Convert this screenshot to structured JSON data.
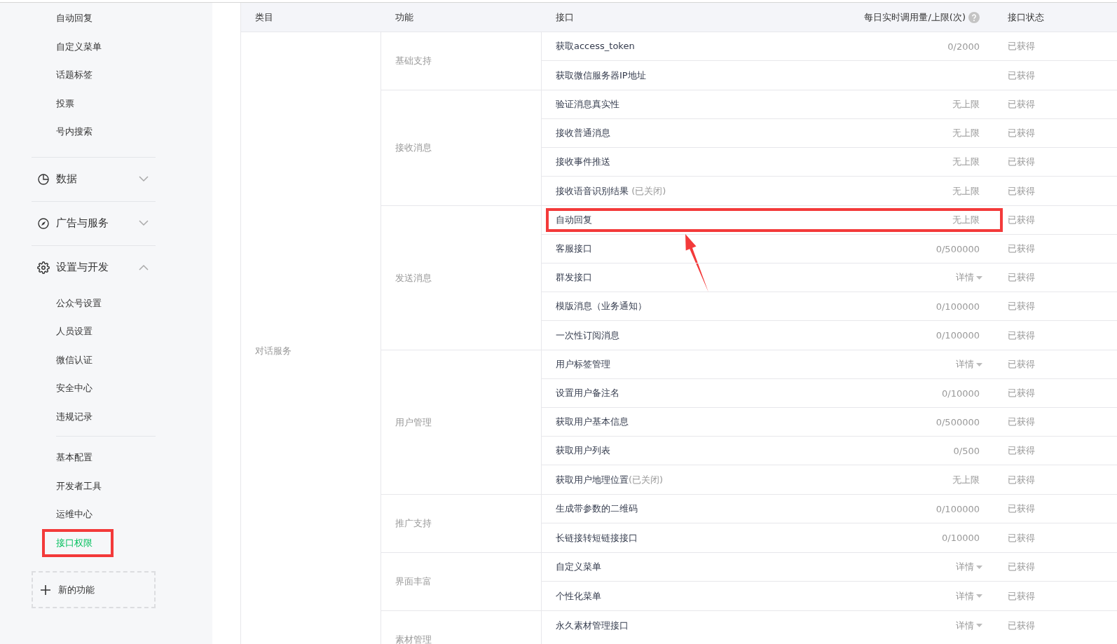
{
  "sidebar": {
    "items": [
      {
        "label": "自动回复",
        "selected": false,
        "annotated": false
      },
      {
        "label": "自定义菜单",
        "selected": false,
        "annotated": false
      },
      {
        "label": "话题标签",
        "selected": false,
        "annotated": false
      },
      {
        "label": "投票",
        "selected": false,
        "annotated": false
      },
      {
        "label": "号内搜索",
        "selected": false,
        "annotated": false
      }
    ],
    "sections": [
      {
        "label": "数据",
        "expanded": false
      },
      {
        "label": "广告与服务",
        "expanded": false
      },
      {
        "label": "设置与开发",
        "expanded": true,
        "groups": [
          [
            {
              "label": "公众号设置",
              "selected": false,
              "annotated": false
            },
            {
              "label": "人员设置",
              "selected": false,
              "annotated": false
            },
            {
              "label": "微信认证",
              "selected": false,
              "annotated": false
            },
            {
              "label": "安全中心",
              "selected": false,
              "annotated": false
            },
            {
              "label": "违规记录",
              "selected": false,
              "annotated": false
            }
          ],
          [
            {
              "label": "基本配置",
              "selected": false,
              "annotated": false
            },
            {
              "label": "开发者工具",
              "selected": false,
              "annotated": false
            },
            {
              "label": "运维中心",
              "selected": false,
              "annotated": false
            },
            {
              "label": "接口权限",
              "selected": true,
              "annotated": true
            }
          ]
        ]
      }
    ],
    "new_feature_button": "新的功能"
  },
  "table": {
    "columns": [
      {
        "label": "类目"
      },
      {
        "label": "功能"
      },
      {
        "label": "接口"
      },
      {
        "label": "每日实时调用量/上限(次)",
        "help": true
      },
      {
        "label": "接口状态"
      }
    ],
    "categories": [
      {
        "name": "对话服务",
        "groups": [
          {
            "name": "基础支持",
            "rows": [
              {
                "api": "获取access_token",
                "quota": "0/2000",
                "kind": "text",
                "status": "已获得",
                "annotated": false
              },
              {
                "api": "获取微信服务器IP地址",
                "status": "已获得",
                "annotated": false
              }
            ]
          },
          {
            "name": "接收消息",
            "rows": [
              {
                "api": "验证消息真实性",
                "quota": "无上限",
                "kind": "text",
                "status": "已获得",
                "annotated": false
              },
              {
                "api": "接收普通消息",
                "quota": "无上限",
                "kind": "text",
                "status": "已获得",
                "annotated": false
              },
              {
                "api": "接收事件推送",
                "quota": "无上限",
                "kind": "text",
                "status": "已获得",
                "annotated": false
              },
              {
                "api": "接收语音识别结果 ",
                "note": "(已关闭)",
                "quota": "无上限",
                "kind": "text",
                "status": "已获得",
                "annotated": false
              }
            ]
          },
          {
            "name": "发送消息",
            "rows": [
              {
                "api": "自动回复",
                "quota": "无上限",
                "kind": "text",
                "status": "已获得",
                "annotated": true
              },
              {
                "api": "客服接口",
                "quota": "0/500000",
                "kind": "text",
                "status": "已获得",
                "annotated": false
              },
              {
                "api": "群发接口",
                "quota": "详情",
                "kind": "details",
                "status": "已获得",
                "annotated": false
              },
              {
                "api": "模版消息（业务通知）",
                "quota": "0/100000",
                "kind": "text",
                "status": "已获得",
                "annotated": false
              },
              {
                "api": "一次性订阅消息",
                "quota": "0/100000",
                "kind": "text",
                "status": "已获得",
                "annotated": false
              }
            ]
          },
          {
            "name": "用户管理",
            "rows": [
              {
                "api": "用户标签管理",
                "quota": "详情",
                "kind": "details",
                "status": "已获得",
                "annotated": false
              },
              {
                "api": "设置用户备注名",
                "quota": "0/10000",
                "kind": "text",
                "status": "已获得",
                "annotated": false
              },
              {
                "api": "获取用户基本信息",
                "quota": "0/500000",
                "kind": "text",
                "status": "已获得",
                "annotated": false
              },
              {
                "api": "获取用户列表",
                "quota": "0/500",
                "kind": "text",
                "status": "已获得",
                "annotated": false
              },
              {
                "api": "获取用户地理位置",
                "note": "(已关闭)",
                "quota": "无上限",
                "kind": "text",
                "status": "已获得",
                "annotated": false
              }
            ]
          },
          {
            "name": "推广支持",
            "rows": [
              {
                "api": "生成带参数的二维码",
                "quota": "0/100000",
                "kind": "text",
                "status": "已获得",
                "annotated": false
              },
              {
                "api": "长链接转短链接接口",
                "quota": "0/10000",
                "kind": "text",
                "status": "已获得",
                "annotated": false
              }
            ]
          },
          {
            "name": "界面丰富",
            "rows": [
              {
                "api": "自定义菜单",
                "quota": "详情",
                "kind": "details",
                "status": "已获得",
                "annotated": false
              },
              {
                "api": "个性化菜单",
                "quota": "详情",
                "kind": "details",
                "status": "已获得",
                "annotated": false
              }
            ]
          },
          {
            "name": "素材管理",
            "rows": [
              {
                "api": "永久素材管理接口",
                "quota": "详情",
                "kind": "details",
                "status": "已获得",
                "annotated": false
              }
            ]
          }
        ]
      }
    ]
  }
}
